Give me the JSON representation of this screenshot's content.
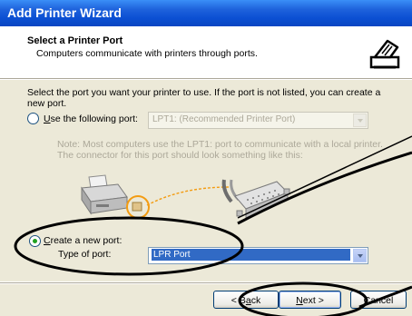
{
  "window": {
    "title": "Add Printer Wizard"
  },
  "header": {
    "title": "Select a Printer Port",
    "subtitle": "Computers communicate with printers through ports."
  },
  "body": {
    "instruction_line1": "Select the port you want your printer to use.  If the port is not listed, you can create a",
    "instruction_line2": "new port.",
    "use_port": {
      "label_u": "U",
      "label_rest": "se the following port:",
      "value": "LPT1: (Recommended Printer Port)",
      "selected": false
    },
    "note_line1": "Note: Most computers use the LPT1: port to communicate with a local printer.",
    "note_line2": "The connector for this port should look something like this:",
    "create_port": {
      "label_u": "C",
      "label_rest": "reate a new port:",
      "type_label": "Type of port:",
      "value": "LPR Port",
      "selected": true
    }
  },
  "footer": {
    "back_pre": "< B",
    "back_u": "a",
    "back_post": "ck",
    "next_u": "N",
    "next_post": "ext >",
    "cancel_label": "Cancel"
  },
  "colors": {
    "titlebar": "#0a46c2",
    "dialog_bg": "#ece9d8",
    "selection": "#316ac5",
    "radio_dot": "#21a121"
  },
  "icons": [
    "printer-header-icon",
    "printer-illustration",
    "parallel-cable-illustration",
    "chevron-down-icon"
  ]
}
